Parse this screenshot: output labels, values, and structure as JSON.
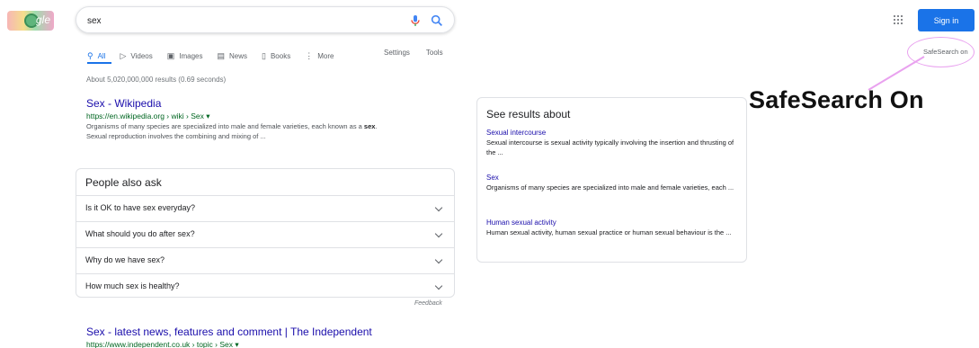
{
  "search": {
    "query": "sex"
  },
  "tabs": [
    {
      "label": "All",
      "icon": "search-icon"
    },
    {
      "label": "Videos",
      "icon": "video-icon"
    },
    {
      "label": "Images",
      "icon": "image-icon"
    },
    {
      "label": "News",
      "icon": "news-icon"
    },
    {
      "label": "Books",
      "icon": "book-icon"
    },
    {
      "label": "More",
      "icon": "more-icon"
    }
  ],
  "tools": {
    "settings": "Settings",
    "tools": "Tools"
  },
  "stats": "About 5,020,000,000 results (0.69 seconds)",
  "result1": {
    "title": "Sex - Wikipedia",
    "url": "https://en.wikipedia.org › wiki › Sex ▾",
    "snippet_line1_a": "Organisms of many species are specialized into male and female varieties, each known as a ",
    "snippet_line1_b": "sex",
    "snippet_line1_c": ".",
    "snippet_line2": "Sexual reproduction involves the combining and mixing of ..."
  },
  "paa": {
    "title": "People also ask",
    "questions": [
      "Is it OK to have sex everyday?",
      "What should you do after sex?",
      "Why do we have sex?",
      "How much sex is healthy?"
    ],
    "feedback": "Feedback"
  },
  "result2": {
    "title": "Sex - latest news, features and comment | The Independent",
    "url": "https://www.independent.co.uk › topic › Sex ▾"
  },
  "side": {
    "title": "See results about",
    "items": [
      {
        "title": "Sexual intercourse",
        "desc": "Sexual intercourse is sexual activity typically involving the insertion and thrusting of the ..."
      },
      {
        "title": "Sex",
        "desc": "Organisms of many species are specialized into male and female varieties, each ..."
      },
      {
        "title": "Human sexual activity",
        "desc": "Human sexual activity, human sexual practice or human sexual behaviour is the ..."
      }
    ]
  },
  "header": {
    "signin": "Sign in",
    "safesearch": "SafeSearch on",
    "logo_text": "gle"
  },
  "annotation": "SafeSearch On",
  "colors": {
    "accent": "#1a73e8",
    "link": "#1a0dab",
    "url": "#006621",
    "highlight": "#e9a2ef"
  }
}
